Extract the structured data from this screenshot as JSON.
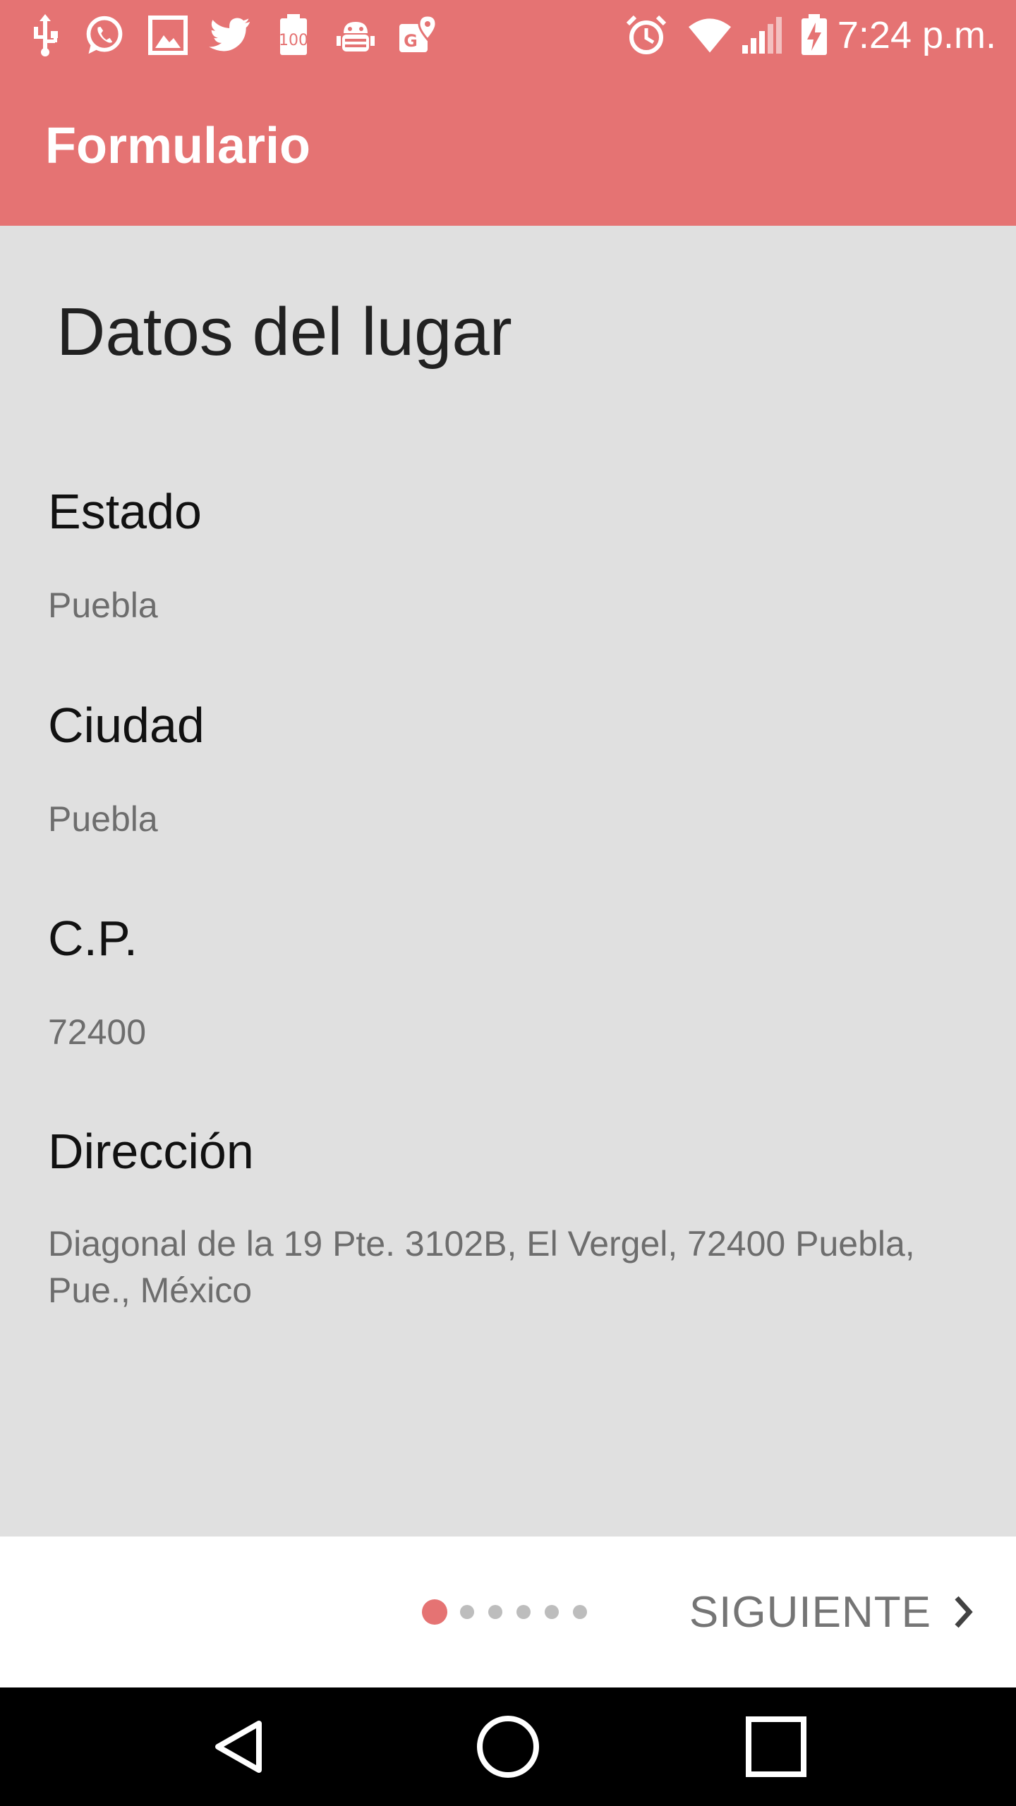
{
  "status_bar": {
    "time": "7:24 p.m.",
    "left_icons": [
      "usb-icon",
      "whatsapp-icon",
      "gallery-icon",
      "twitter-icon",
      "battery-100-app-icon",
      "android-debug-icon",
      "maps-icon"
    ],
    "right_icons": [
      "alarm-icon",
      "wifi-icon",
      "signal-icon",
      "battery-charging-icon"
    ]
  },
  "app_bar": {
    "title": "Formulario"
  },
  "colors": {
    "accent": "#e57373",
    "content_bg": "#e0e0e0",
    "label": "#111111",
    "value": "#6d6d6d"
  },
  "form": {
    "section_title": "Datos del lugar",
    "fields": [
      {
        "label": "Estado",
        "value": "Puebla"
      },
      {
        "label": "Ciudad",
        "value": "Puebla"
      },
      {
        "label": "C.P.",
        "value": "72400"
      },
      {
        "label": "Dirección",
        "value_line1": "Diagonal de la 19 Pte. 3102B, El Vergel, 72400 Puebla,",
        "value_line2": "Pue., México"
      }
    ]
  },
  "stepper": {
    "total_steps": 6,
    "current_step": 1,
    "next_label": "SIGUIENTE"
  },
  "nav_bar": {
    "buttons": [
      "back-icon",
      "home-icon",
      "recents-icon"
    ]
  }
}
